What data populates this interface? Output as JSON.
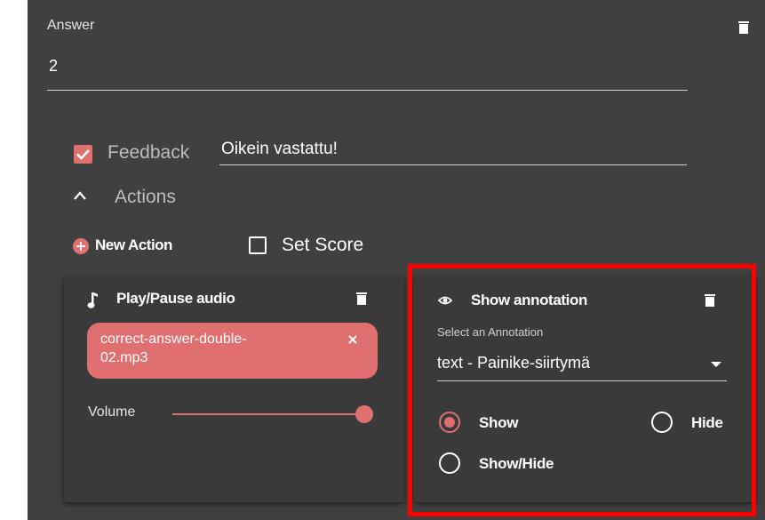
{
  "answer": {
    "label": "Answer",
    "value": "2"
  },
  "feedback": {
    "checked": true,
    "label": "Feedback",
    "value": "Oikein vastattu!"
  },
  "actions": {
    "label": "Actions",
    "expanded": true,
    "new_action_label": "New Action",
    "set_score_label": "Set Score"
  },
  "audio_action": {
    "title": "Play/Pause audio",
    "file_chip": "correct-answer-double-02.mp3",
    "file_chip_line1": "correct-answer-double-",
    "file_chip_line2": "02.mp3",
    "volume_label": "Volume",
    "volume_level": 1.0
  },
  "annotation_action": {
    "title": "Show annotation",
    "select_label": "Select an Annotation",
    "selected_value": "text - Painike-siirtymä",
    "options": {
      "show": "Show",
      "hide": "Hide",
      "show_hide": "Show/Hide"
    },
    "selected_option": "show"
  },
  "colors": {
    "panel_background": "#404040",
    "accent": "#e07070",
    "highlight_border": "#ff0000"
  }
}
